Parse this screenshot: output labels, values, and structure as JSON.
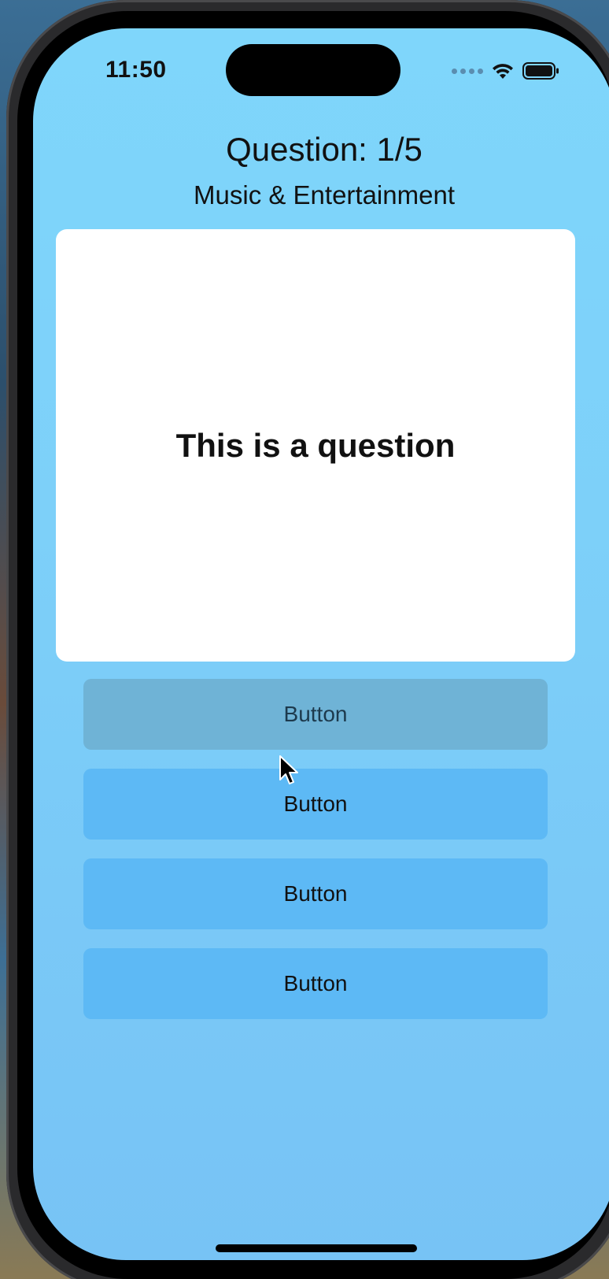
{
  "status_bar": {
    "time": "11:50"
  },
  "header": {
    "question_count": "Question: 1/5",
    "category": "Music & Entertainment"
  },
  "question": {
    "text": "This is a question"
  },
  "answers": [
    {
      "label": "Button",
      "state": "pressed"
    },
    {
      "label": "Button",
      "state": "normal"
    },
    {
      "label": "Button",
      "state": "normal"
    },
    {
      "label": "Button",
      "state": "normal"
    }
  ],
  "colors": {
    "background": "#7dd0f9",
    "card": "#ffffff",
    "button": "#5db9f5",
    "button_pressed": "#6fb3d6"
  }
}
